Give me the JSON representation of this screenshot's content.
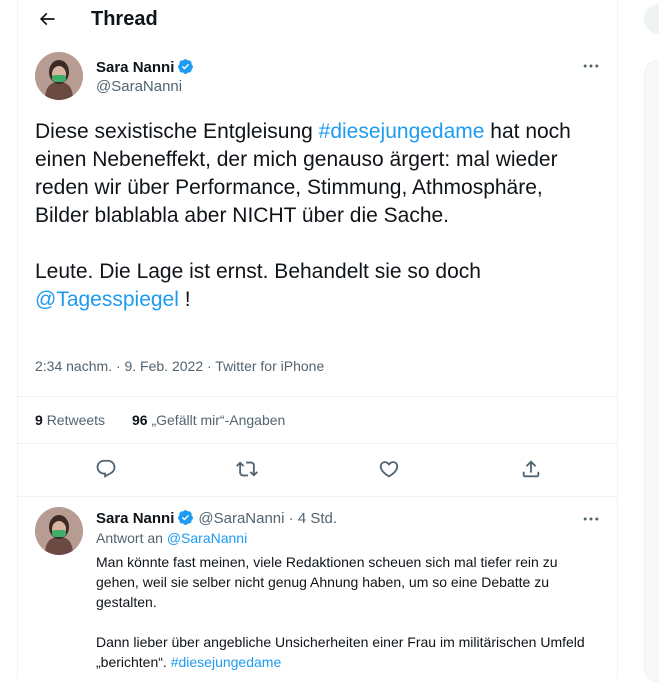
{
  "header": {
    "title": "Thread",
    "back_icon": "arrow-left-icon"
  },
  "tweet": {
    "author_name": "Sara Nanni",
    "author_handle": "@SaraNanni",
    "text_part1": "Diese sexistische Entgleisung ",
    "hashtag": "#diesejungedame",
    "text_part2": " hat noch einen Nebeneffekt, der mich genauso ärgert: mal wieder reden wir über Performance, Stimmung, Athmosphäre, Bilder blablabla aber NICHT über die Sache.",
    "text_part3": "Leute. Die Lage ist ernst. Behandelt sie so doch ",
    "mention": "@Tagesspiegel",
    "text_part4": " !",
    "timestamp": "2:34 nachm. · 9. Feb. 2022 · ",
    "source": "Twitter for iPhone",
    "retweets_count": "9",
    "retweets_label": "Retweets",
    "likes_count": "96",
    "likes_label": "„Gefällt mir“-Angaben"
  },
  "reply": {
    "author_name": "Sara Nanni",
    "author_handle": "@SaraNanni",
    "time": " · 4 Std.",
    "reply_to_label": "Antwort an ",
    "reply_to_handle": "@SaraNanni",
    "text1": "Man könnte fast meinen, viele Redaktionen scheuen sich mal tiefer rein zu gehen, weil sie selber nicht genug Ahnung haben, um so eine Debatte zu gestalten.",
    "text2_part1": "Dann lieber über angebliche Unsicherheiten einer Frau im militärischen Umfeld „berichten“. ",
    "text2_hashtag": "#diesejungedame"
  },
  "colors": {
    "accent": "#1d9bf0",
    "muted": "#536471",
    "text": "#0f1419",
    "border": "#eff3f4"
  }
}
